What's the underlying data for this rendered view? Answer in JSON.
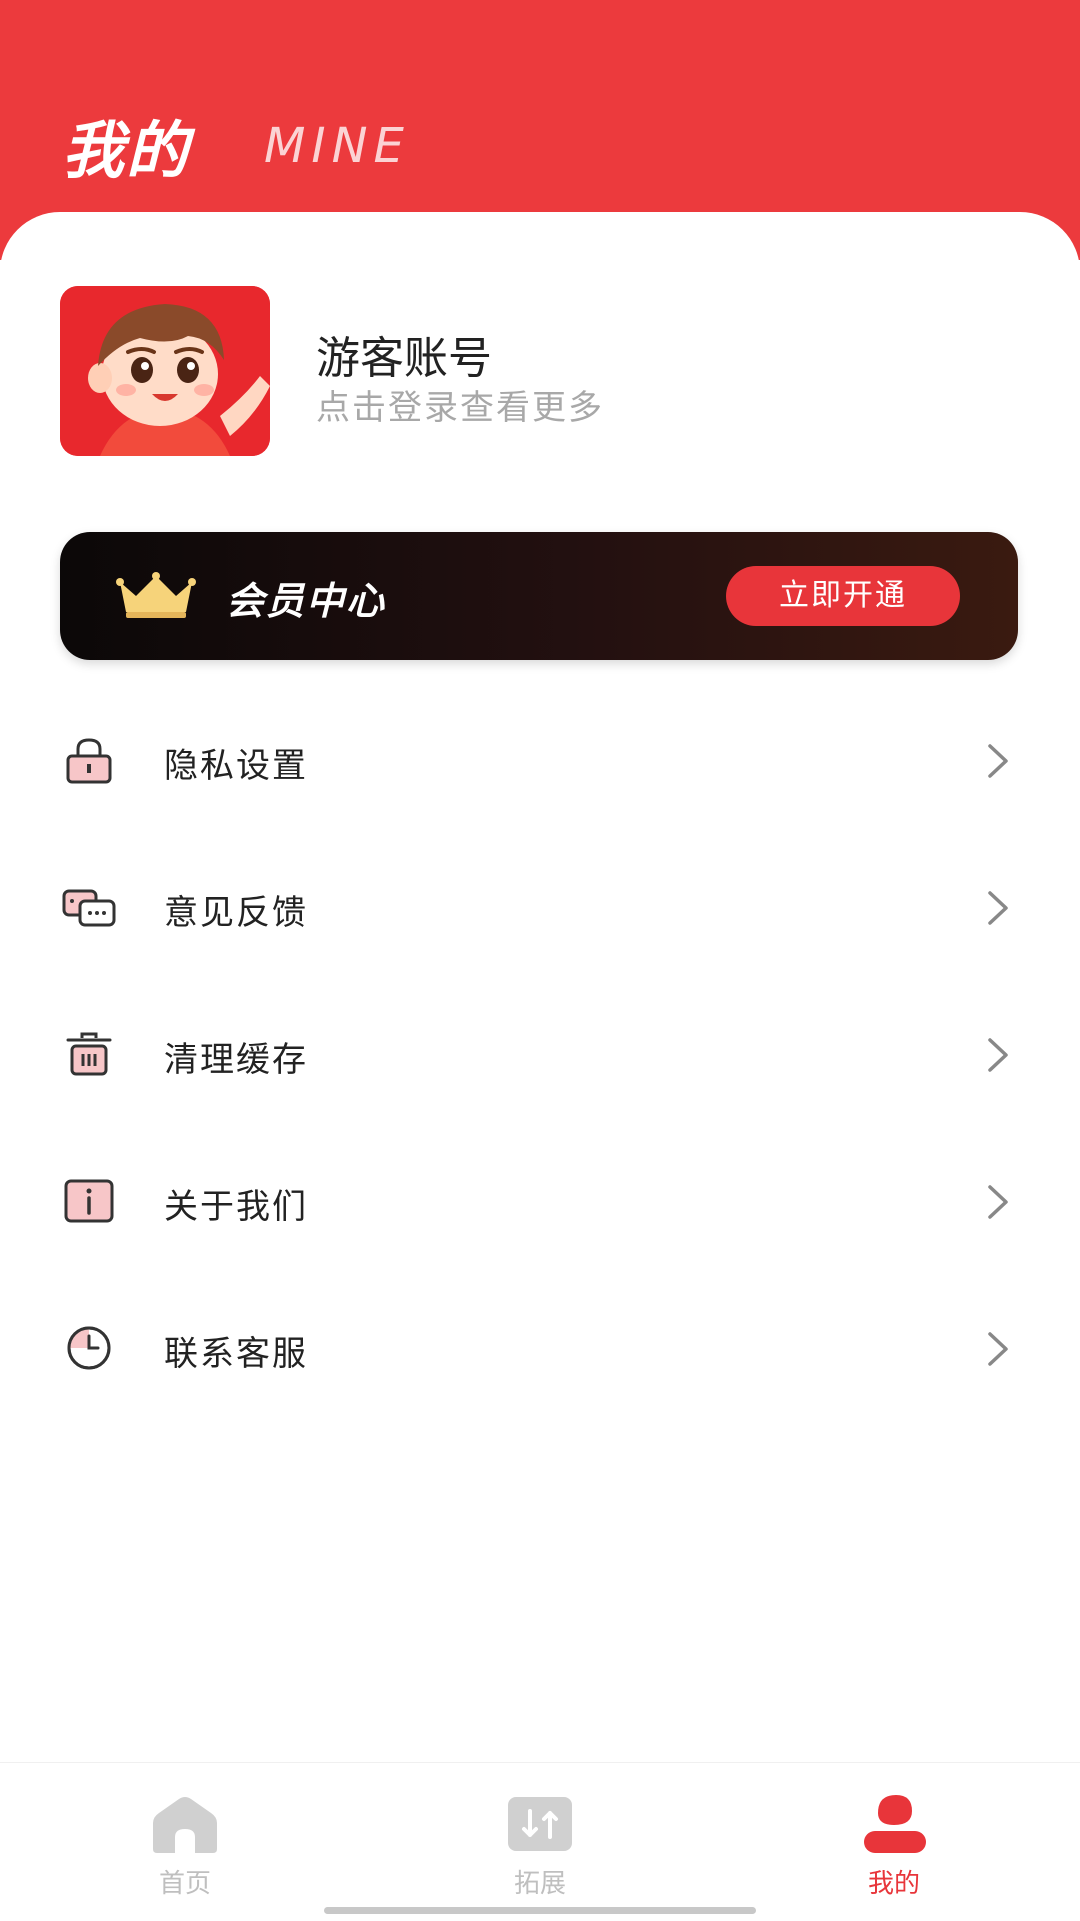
{
  "header": {
    "title": "我的",
    "subtitle": "MINE"
  },
  "profile": {
    "name": "游客账号",
    "hint": "点击登录查看更多"
  },
  "vip": {
    "title": "会员中心",
    "button_label": "立即开通",
    "icon": "crown-icon"
  },
  "menu": {
    "items": [
      {
        "label": "隐私设置",
        "icon": "lock-icon"
      },
      {
        "label": "意见反馈",
        "icon": "feedback-chat-icon"
      },
      {
        "label": "清理缓存",
        "icon": "trash-icon"
      },
      {
        "label": "关于我们",
        "icon": "info-icon"
      },
      {
        "label": "联系客服",
        "icon": "clock-service-icon"
      }
    ]
  },
  "tabbar": {
    "items": [
      {
        "label": "首页",
        "icon": "home-icon",
        "active": false
      },
      {
        "label": "拓展",
        "icon": "expand-icon",
        "active": false
      },
      {
        "label": "我的",
        "icon": "user-icon",
        "active": true
      }
    ]
  },
  "colors": {
    "brand_red": "#ec3a3d",
    "button_red": "#e8353a",
    "inactive_gray": "#bfbfbf",
    "banner_dark": "#0b0808"
  }
}
